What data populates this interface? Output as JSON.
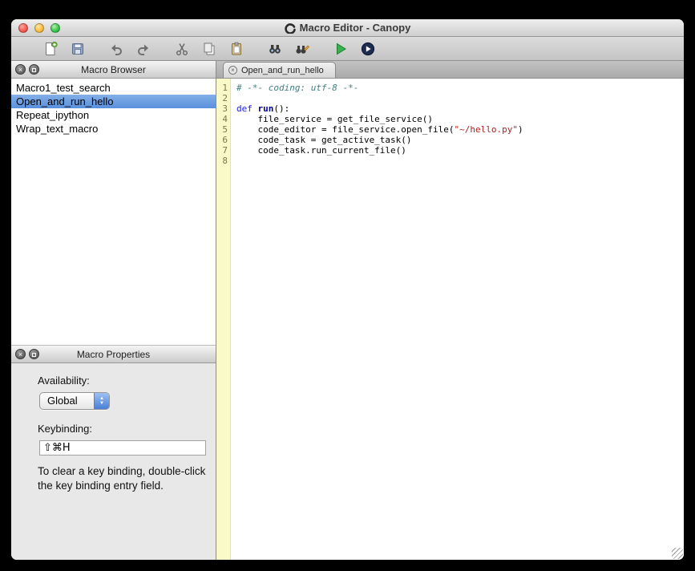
{
  "window": {
    "title": "Macro Editor - Canopy"
  },
  "colors": {
    "selection_top": "#83b0e8",
    "selection_bottom": "#5a8fdc",
    "gutter_bg": "#fafac8",
    "gutter_border": "#e3e3ae",
    "gutter_num": "#7a7a45",
    "comment": "#3f8080",
    "keyword": "#1a1ae6",
    "func": "#00009a",
    "string": "#b22222"
  },
  "toolbar": {
    "items": [
      {
        "name": "new-macro-icon",
        "sep": false
      },
      {
        "name": "save-icon",
        "sep": false
      },
      {
        "name": "undo-icon",
        "sep": true
      },
      {
        "name": "redo-icon",
        "sep": false
      },
      {
        "name": "cut-icon",
        "sep": true
      },
      {
        "name": "copy-icon",
        "sep": false
      },
      {
        "name": "paste-icon",
        "sep": false
      },
      {
        "name": "find-icon",
        "sep": true
      },
      {
        "name": "find-replace-icon",
        "sep": false
      },
      {
        "name": "run-icon",
        "sep": true
      },
      {
        "name": "run-app-icon",
        "sep": false
      }
    ]
  },
  "macro_browser": {
    "title": "Macro Browser",
    "items": [
      {
        "label": "Macro1_test_search",
        "selected": false
      },
      {
        "label": "Open_and_run_hello",
        "selected": true
      },
      {
        "label": "Repeat_ipython",
        "selected": false
      },
      {
        "label": "Wrap_text_macro",
        "selected": false
      }
    ]
  },
  "macro_properties": {
    "title": "Macro Properties",
    "availability_label": "Availability:",
    "availability_value": "Global",
    "keybinding_label": "Keybinding:",
    "keybinding_value": "⇧⌘H",
    "help_text": "To clear a key binding, double-click the key binding entry field."
  },
  "editor": {
    "tab": "Open_and_run_hello",
    "lines": [
      {
        "n": 1,
        "segments": [
          {
            "t": "# -*- coding: utf-8 -*-",
            "c": "comment"
          }
        ]
      },
      {
        "n": 2,
        "segments": []
      },
      {
        "n": 3,
        "segments": [
          {
            "t": "def",
            "c": "keyword"
          },
          {
            "t": " ",
            "c": "plain"
          },
          {
            "t": "run",
            "c": "func"
          },
          {
            "t": "():",
            "c": "plain"
          }
        ]
      },
      {
        "n": 4,
        "segments": [
          {
            "t": "    file_service = get_file_service()",
            "c": "plain"
          }
        ]
      },
      {
        "n": 5,
        "segments": [
          {
            "t": "    code_editor = file_service.open_file(",
            "c": "plain"
          },
          {
            "t": "\"~/hello.py\"",
            "c": "string"
          },
          {
            "t": ")",
            "c": "plain"
          }
        ]
      },
      {
        "n": 6,
        "segments": [
          {
            "t": "    code_task = get_active_task()",
            "c": "plain"
          }
        ]
      },
      {
        "n": 7,
        "segments": [
          {
            "t": "    code_task.run_current_file()",
            "c": "plain"
          }
        ]
      },
      {
        "n": 8,
        "segments": []
      }
    ]
  }
}
